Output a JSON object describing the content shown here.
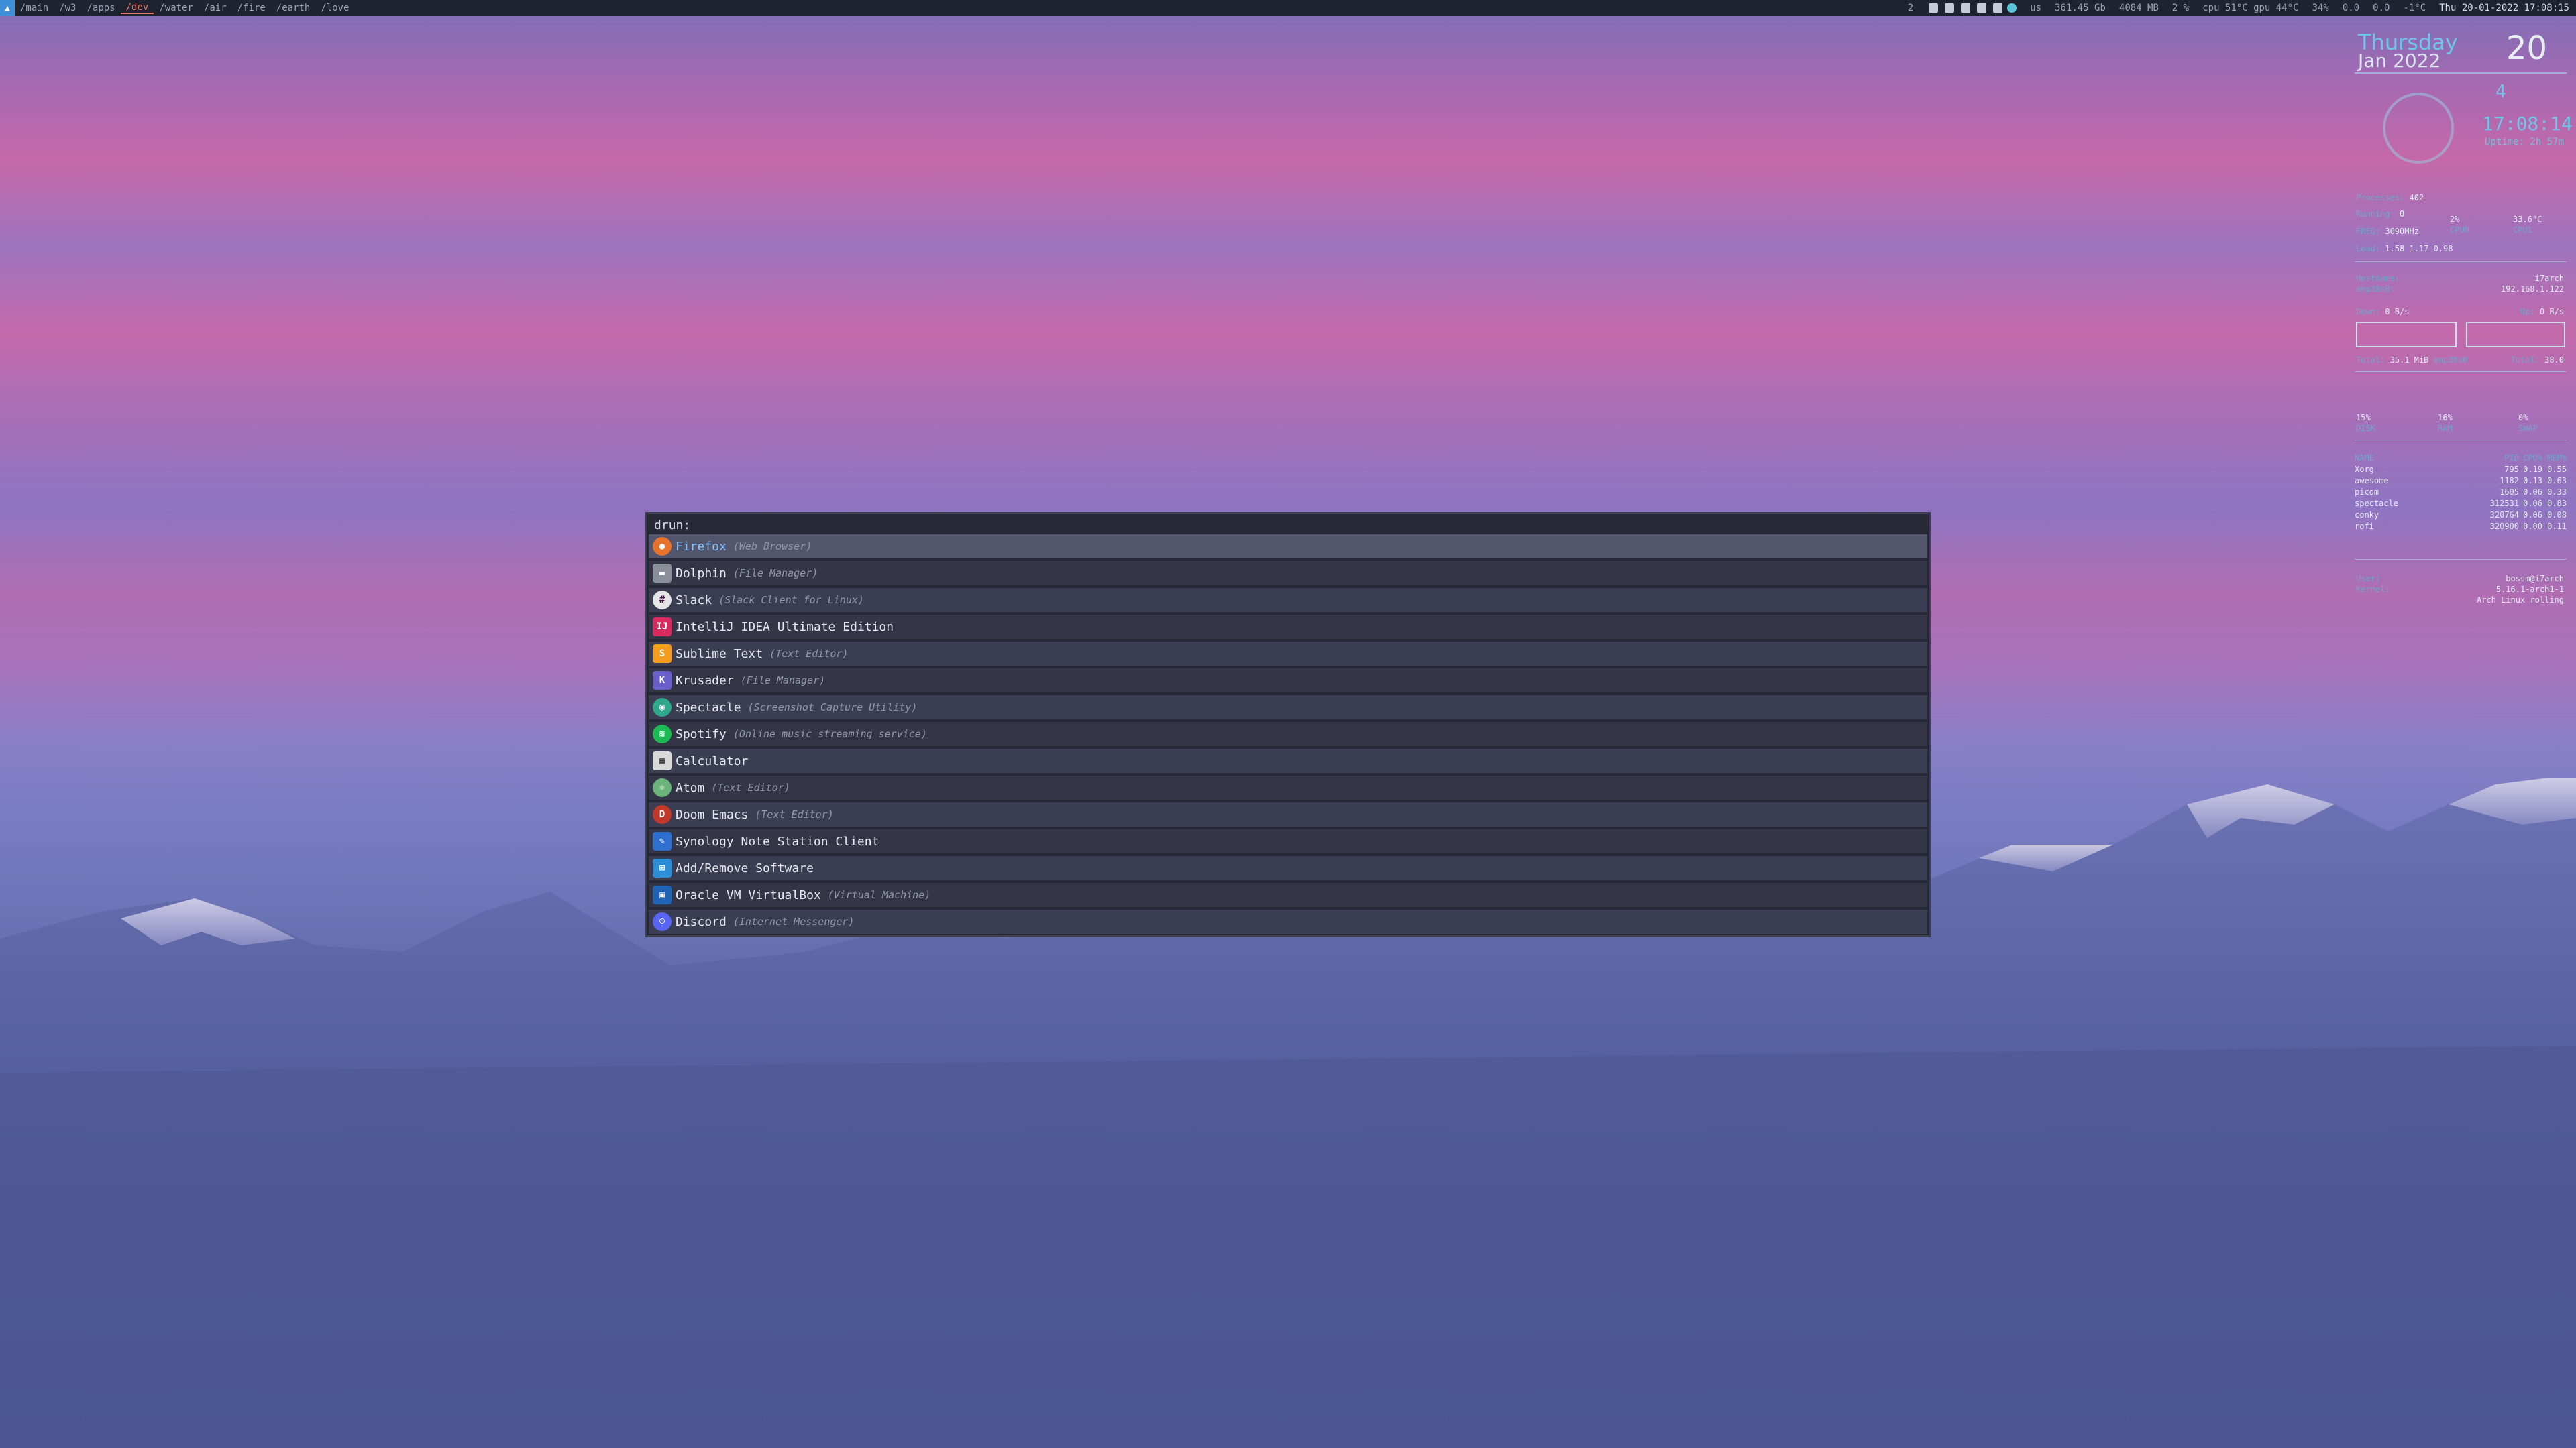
{
  "topbar": {
    "launcher_icon": "arch-icon",
    "workspaces": [
      {
        "label": "/main",
        "active": false
      },
      {
        "label": "/w3",
        "active": false
      },
      {
        "label": "/apps",
        "active": false
      },
      {
        "label": "/dev",
        "active": true
      },
      {
        "label": "/water",
        "active": false
      },
      {
        "label": "/air",
        "active": false
      },
      {
        "label": "/fire",
        "active": false
      },
      {
        "label": "/earth",
        "active": false
      },
      {
        "label": "/love",
        "active": false
      }
    ],
    "modules": [
      {
        "label": "2"
      },
      {
        "label": "us"
      },
      {
        "label": "361.45 Gb"
      },
      {
        "label": "4084 MB"
      },
      {
        "label": "2 %"
      },
      {
        "label": "cpu 51°C gpu 44°C"
      },
      {
        "label": "34%"
      },
      {
        "label": "0.0"
      },
      {
        "label": "0.0"
      },
      {
        "label": "-1°C"
      }
    ],
    "clock": "Thu 20-01-2022 17:08:15"
  },
  "conky": {
    "day": "Thursday",
    "month_year": "Jan 2022",
    "day_number": "20",
    "circle_number": "4",
    "time": "17:08:14",
    "uptime": "Uptime: 2h 57m",
    "processes_label": "Processes:",
    "processes": "402",
    "running_label": "Running:",
    "running": "0",
    "freq_label": "FREQ:",
    "freq": "3090MHz",
    "load_label": "Load:",
    "load": "1.58 1.17 0.98",
    "cpu0_pct": "2%",
    "cpu0_label": "CPU0",
    "cpu1_temp": "33.6°C",
    "cpu1_label": "CPU1",
    "hostname_label": "Hostname:",
    "hostname": "i7arch",
    "iface_label": "enp38s0:",
    "ip": "192.168.1.122",
    "down_label": "Down:",
    "down": "0 B/s",
    "up_label": "Up:",
    "up": "0 B/s",
    "total_label": "Total:",
    "total_down": "35.1 MiB",
    "iface2": "enp38s0",
    "total_up_label": "Total:",
    "total_up": "38.0",
    "disk_pct": "15%",
    "disk_label": "DISK",
    "ram_pct": "16%",
    "ram_label": "RAM",
    "swap_pct": "0%",
    "swap_label": "SWAP",
    "proc_header": {
      "name": "NAME",
      "pid": "PID",
      "cpu": "CPU%",
      "mem": "MEM%"
    },
    "processes_list": [
      {
        "name": "Xorg",
        "pid": "795",
        "cpu": "0.19",
        "mem": "0.55"
      },
      {
        "name": "awesome",
        "pid": "1182",
        "cpu": "0.13",
        "mem": "0.63"
      },
      {
        "name": "picom",
        "pid": "1605",
        "cpu": "0.06",
        "mem": "0.33"
      },
      {
        "name": "spectacle",
        "pid": "312531",
        "cpu": "0.06",
        "mem": "0.83"
      },
      {
        "name": "conky",
        "pid": "320764",
        "cpu": "0.06",
        "mem": "0.08"
      },
      {
        "name": "rofi",
        "pid": "320900",
        "cpu": "0.00",
        "mem": "0.11"
      }
    ],
    "user_label": "User:",
    "user": "bossm@i7arch",
    "kernel_label": "Kernel:",
    "kernel": "5.16.1-arch1-1",
    "distro": "Arch Linux rolling"
  },
  "rofi": {
    "prompt": "drun:",
    "items": [
      {
        "name": "Firefox",
        "desc": "(Web Browser)",
        "icon": "firefox-icon",
        "color": "#e8732c"
      },
      {
        "name": "Dolphin",
        "desc": "(File Manager)",
        "icon": "dolphin-icon",
        "color": "#8a8f99"
      },
      {
        "name": "Slack",
        "desc": "(Slack Client for Linux)",
        "icon": "slack-icon",
        "color": "#e6e6e6"
      },
      {
        "name": "IntelliJ IDEA Ultimate Edition",
        "desc": "",
        "icon": "intellij-icon",
        "color": "#d62b5f"
      },
      {
        "name": "Sublime Text",
        "desc": "(Text Editor)",
        "icon": "sublime-icon",
        "color": "#f39c1d"
      },
      {
        "name": "Krusader",
        "desc": "(File Manager)",
        "icon": "krusader-icon",
        "color": "#6a5fc8"
      },
      {
        "name": "Spectacle",
        "desc": "(Screenshot Capture Utility)",
        "icon": "spectacle-icon",
        "color": "#2fa88c"
      },
      {
        "name": "Spotify",
        "desc": "(Online music streaming service)",
        "icon": "spotify-icon",
        "color": "#1db954"
      },
      {
        "name": "Calculator",
        "desc": "",
        "icon": "calculator-icon",
        "color": "#d9d9d9"
      },
      {
        "name": "Atom",
        "desc": "(Text Editor)",
        "icon": "atom-icon",
        "color": "#6ab37a"
      },
      {
        "name": "Doom Emacs",
        "desc": "(Text Editor)",
        "icon": "doom-emacs-icon",
        "color": "#c0392b"
      },
      {
        "name": "Synology Note Station Client",
        "desc": "",
        "icon": "synology-note-icon",
        "color": "#2f6fd0"
      },
      {
        "name": "Add/Remove Software",
        "desc": "",
        "icon": "software-icon",
        "color": "#2c8fd6"
      },
      {
        "name": "Oracle VM VirtualBox",
        "desc": "(Virtual Machine)",
        "icon": "virtualbox-icon",
        "color": "#1f63b5"
      },
      {
        "name": "Discord",
        "desc": "(Internet Messenger)",
        "icon": "discord-icon",
        "color": "#5865f2"
      }
    ]
  }
}
